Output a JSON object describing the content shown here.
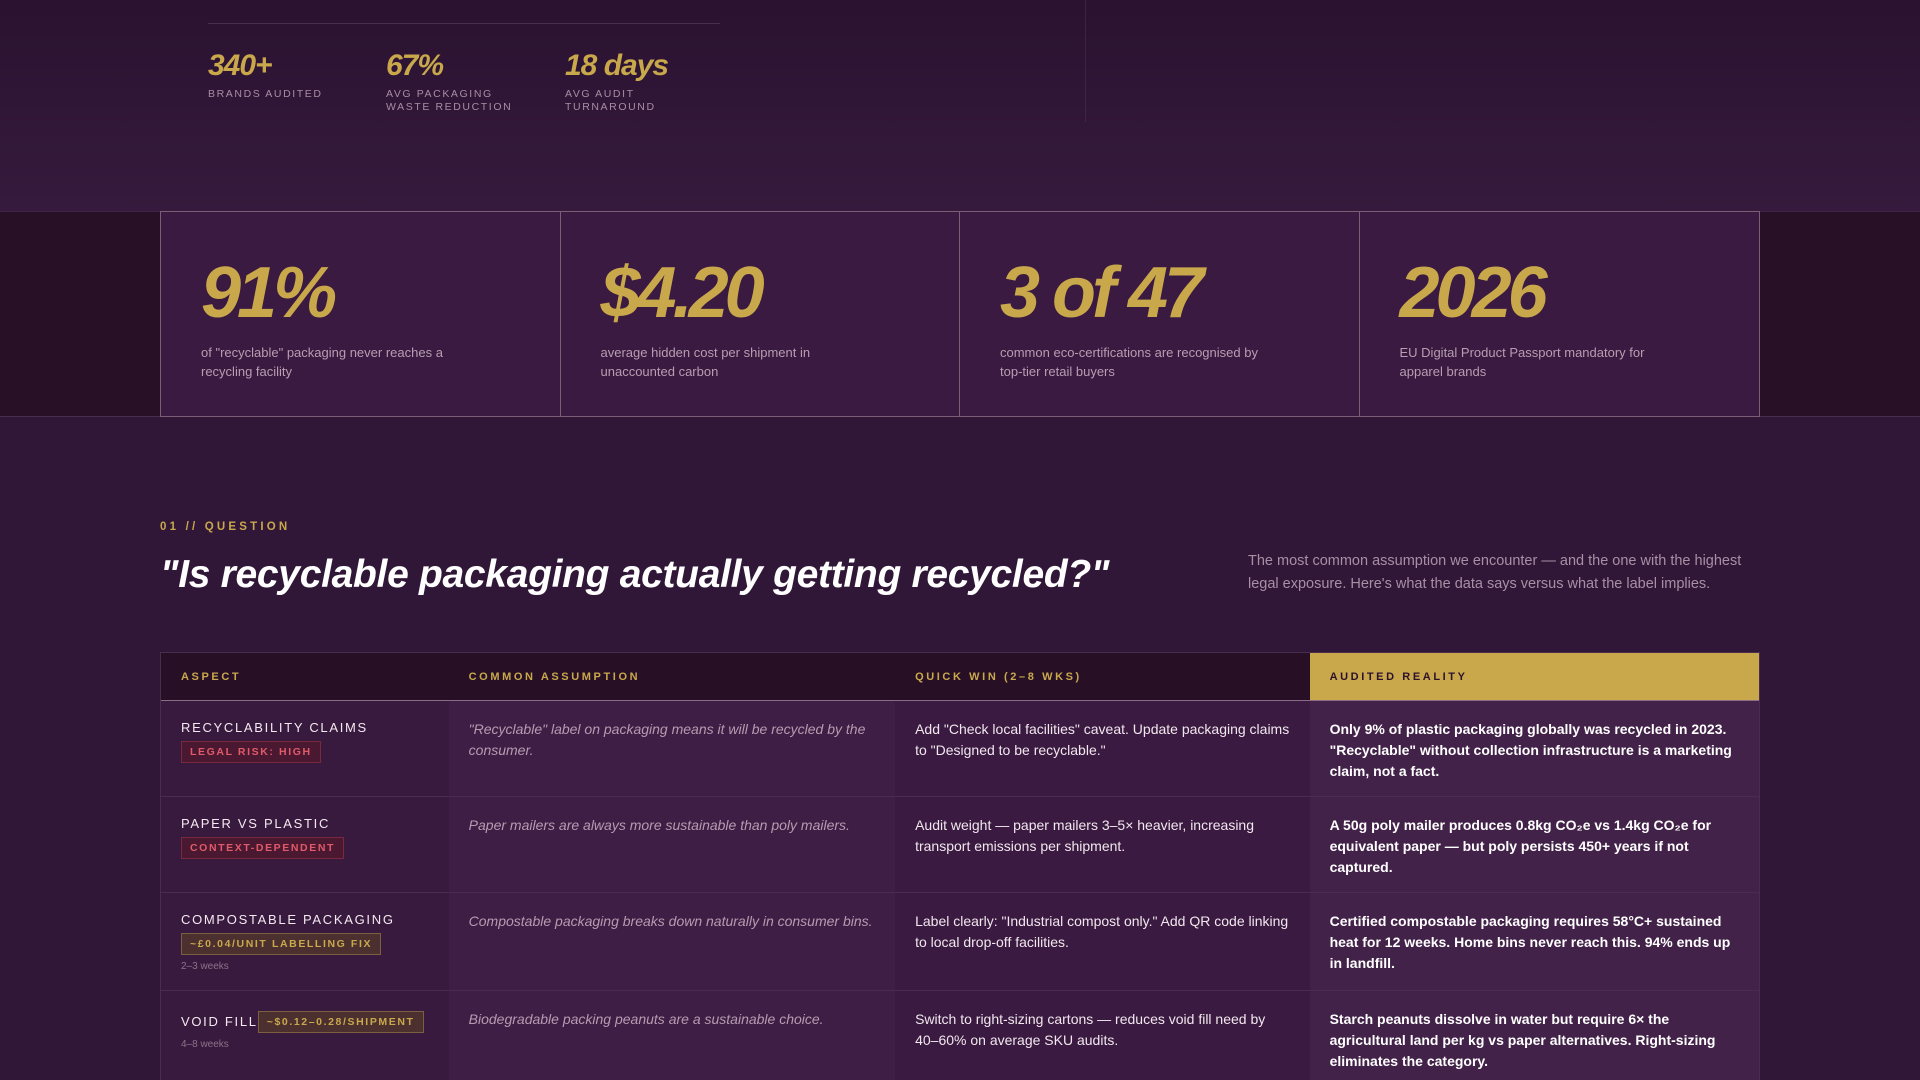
{
  "hero": {
    "stats": [
      {
        "value": "340+",
        "label": "BRANDS AUDITED"
      },
      {
        "value": "67%",
        "label": "AVG PACKAGING WASTE REDUCTION"
      },
      {
        "value": "18 days",
        "label": "AVG AUDIT TURNAROUND"
      }
    ]
  },
  "statband": [
    {
      "value": "91%",
      "desc": "of \"recyclable\" packaging never reaches a recycling facility"
    },
    {
      "value": "$4.20",
      "desc": "average hidden cost per shipment in unaccounted carbon"
    },
    {
      "value": "3 of 47",
      "desc": "common eco-certifications are recognised by top-tier retail buyers"
    },
    {
      "value": "2026",
      "desc": "EU Digital Product Passport mandatory for apparel brands"
    }
  ],
  "section": {
    "eyebrow": "01 // QUESTION",
    "question": "\"Is recyclable packaging actually getting recycled?\"",
    "intro": "The most common assumption we encounter — and the one with the highest legal exposure. Here's what the data says versus what the label implies."
  },
  "table": {
    "headers": [
      "ASPECT",
      "COMMON ASSUMPTION",
      "QUICK WIN (2–8 WKS)",
      "AUDITED REALITY"
    ],
    "rows": [
      {
        "aspect": "RECYCLABILITY CLAIMS",
        "badge": "LEGAL RISK: HIGH",
        "weeks": "",
        "assumption": "\"Recyclable\" label on packaging means it will be recycled by the consumer.",
        "quick": "Add \"Check local facilities\" caveat. Update packaging claims to \"Designed to be recyclable.\"",
        "reality": "Only 9% of plastic packaging globally was recycled in 2023. \"Recyclable\" without collection infrastructure is a marketing claim, not a fact."
      },
      {
        "aspect": "PAPER VS PLASTIC",
        "badge": "CONTEXT-DEPENDENT",
        "weeks": "",
        "assumption": "Paper mailers are always more sustainable than poly mailers.",
        "quick": "Audit weight — paper mailers 3–5× heavier, increasing transport emissions per shipment.",
        "reality": "A 50g poly mailer produces 0.8kg CO₂e vs 1.4kg CO₂e for equivalent paper — but poly persists 450+ years if not captured."
      },
      {
        "aspect": "COMPOSTABLE PACKAGING",
        "badge": "~£0.04/UNIT LABELLING FIX",
        "weeks": "2–3 weeks",
        "assumption": "Compostable packaging breaks down naturally in consumer bins.",
        "quick": "Label clearly: \"Industrial compost only.\" Add QR code linking to local drop-off facilities.",
        "reality": "Certified compostable packaging requires 58°C+ sustained heat for 12 weeks. Home bins never reach this. 94% ends up in landfill."
      },
      {
        "aspect": "VOID FILL",
        "badge": "~$0.12–0.28/SHIPMENT",
        "weeks": "4–8 weeks",
        "assumption": "Biodegradable packing peanuts are a sustainable choice.",
        "quick": "Switch to right-sizing cartons — reduces void fill need by 40–60% on average SKU audits.",
        "reality": "Starch peanuts dissolve in water but require 6× the agricultural land per kg vs paper alternatives. Right-sizing eliminates the category."
      }
    ]
  }
}
